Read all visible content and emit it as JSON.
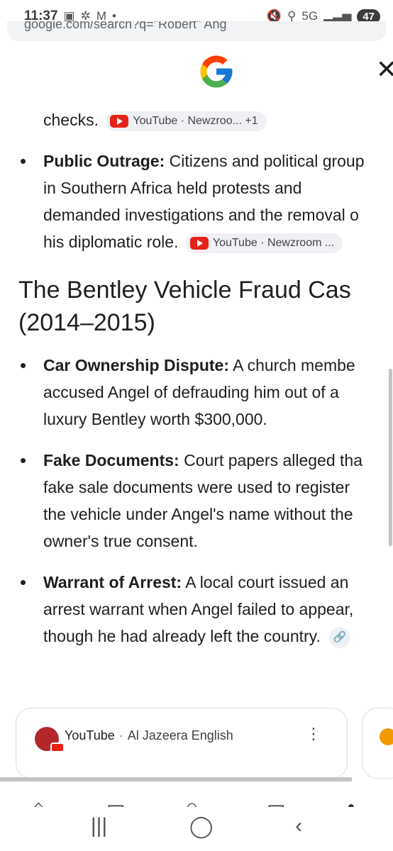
{
  "status_bar": {
    "time": "11:37",
    "left_icons": [
      "screenshot-icon",
      "sync-icon",
      "gmail-icon",
      "dot-icon"
    ],
    "network": "5G",
    "battery": "47"
  },
  "url_bar": {
    "text": "google.com/search?q=\"Robert\" Ang"
  },
  "header": {
    "logo": "google-g-logo",
    "close_label": "✕"
  },
  "content": {
    "top_fragment": {
      "text": "checks.",
      "chip": "YouTube · Newzroo... +1"
    },
    "public_outrage": {
      "label": "Public Outrage:",
      "line1": "Citizens and political group",
      "line2": "in Southern Africa held protests and",
      "line3": "demanded investigations and the removal o",
      "line4": "his diplomatic role.",
      "chip": "YouTube · Newzroom ..."
    },
    "heading": {
      "line1": "The Bentley Vehicle Fraud Cas",
      "line2": "(2014–2015)"
    },
    "bullets": [
      {
        "label": "Car Ownership Dispute:",
        "line1": "A church membe",
        "line2": "accused Angel of defrauding him out of a",
        "line3": "luxury Bentley worth $300,000."
      },
      {
        "label": "Fake Documents:",
        "line1": "Court papers alleged tha",
        "line2": "fake sale documents were used to register",
        "line3": "the vehicle under Angel's name without the",
        "line4": "owner's true consent."
      },
      {
        "label": "Warrant of Arrest:",
        "line1": "A local court issued an",
        "line2": "arrest warrant when Angel failed to appear,",
        "line3": "though he had already left the country."
      }
    ]
  },
  "source_card": {
    "source": "YouTube",
    "separator": "·",
    "channel": "Al Jazeera English",
    "menu": "⋮"
  },
  "system_nav": {
    "recents": "|||",
    "home": "◯",
    "back": "‹"
  },
  "colors": {
    "youtube_red": "#e62117",
    "chip_bg": "#eef0f3",
    "text": "#1f1f1f"
  }
}
